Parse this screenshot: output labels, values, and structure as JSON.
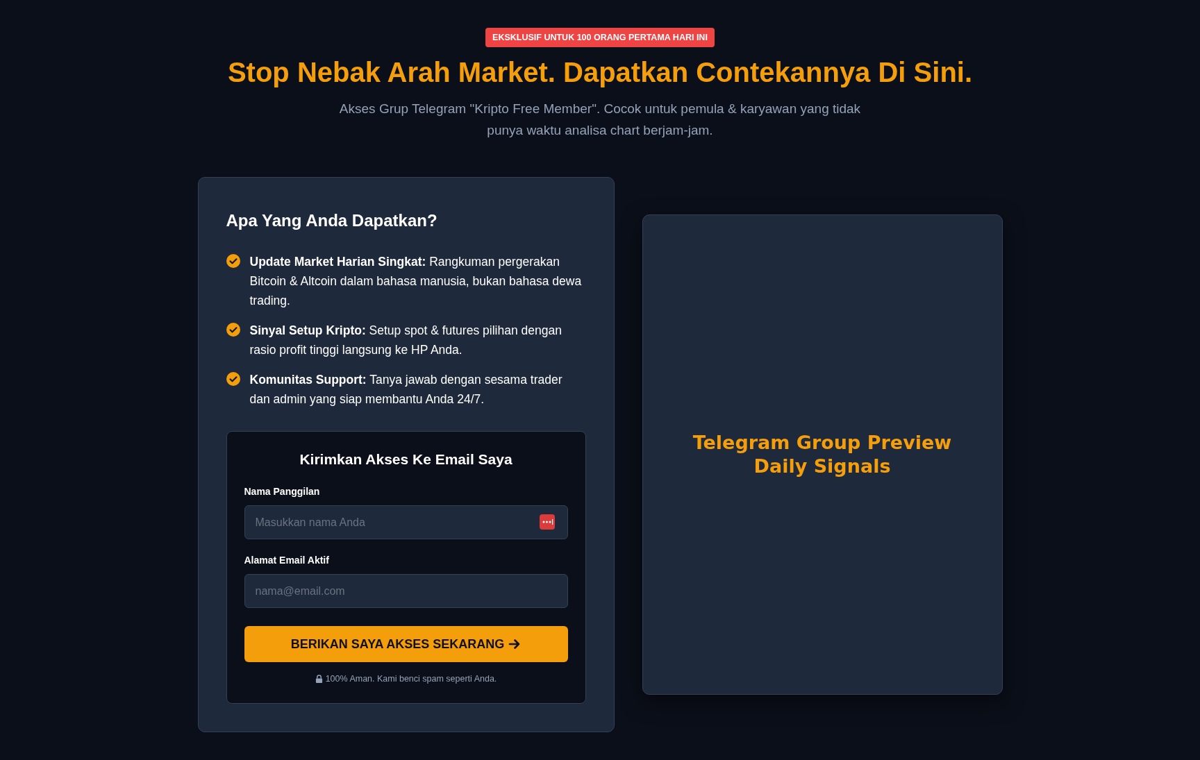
{
  "badge": "EKSKLUSIF UNTUK 100 ORANG PERTAMA HARI INI",
  "headline": "Stop Nebak Arah Market. Dapatkan Contekannya Di Sini.",
  "subheadline": "Akses Grup Telegram \"Kripto Free Member\". Cocok untuk pemula & karyawan yang tidak punya waktu analisa chart berjam-jam.",
  "benefits": {
    "title": "Apa Yang Anda Dapatkan?",
    "items": [
      {
        "text": "**Update Market Harian Singkat:** Rangkuman pergerakan Bitcoin & Altcoin dalam bahasa manusia, bukan bahasa dewa trading."
      },
      {
        "text": "**Sinyal Setup Kripto:** Setup spot & futures pilihan dengan rasio profit tinggi langsung ke HP Anda."
      },
      {
        "text": "**Komunitas Support:** Tanya jawab dengan sesama trader dan admin yang siap membantu Anda 24/7."
      }
    ]
  },
  "form": {
    "title": "Kirimkan Akses Ke Email Saya",
    "fields": [
      {
        "label": "Nama Panggilan",
        "placeholder": "Masukkan nama Anda",
        "password_manager": true
      },
      {
        "label": "Alamat Email Aktif",
        "placeholder": "nama@email.com",
        "password_manager": false
      }
    ],
    "submit": "BERIKAN SAYA AKSES SEKARANG",
    "note": "100% Aman. Kami benci spam seperti Anda."
  },
  "preview": {
    "lines": [
      "Telegram Group Preview",
      "Daily Signals"
    ]
  }
}
